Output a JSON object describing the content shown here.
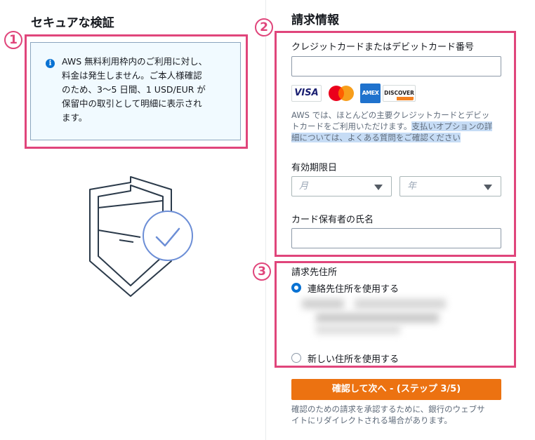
{
  "left": {
    "heading": "セキュアな検証",
    "info_lines": [
      "AWS 無料利用枠内のご利用に対し、",
      "料金は発生しません。ご本人様確認",
      "のため、3〜5 日間、1 USD/EUR が",
      "保留中の取引として明細に表示され",
      "ます。"
    ],
    "info_icon": "i"
  },
  "badges": {
    "one": "1",
    "two": "2",
    "three": "3"
  },
  "billing": {
    "heading": "請求情報",
    "card_number_label": "クレジットカードまたはデビットカード番号",
    "card_number_value": "",
    "card_logos": {
      "visa": "VISA",
      "amex": "AMEX",
      "discover": "DISCOVER"
    },
    "note_line1": "AWS では、ほとんどの主要クレジットカードとデビッ",
    "note_line2_plain": "トカードをご利用いただけます。",
    "note_line2_link": "支払いオプションの詳",
    "note_line3_link": "細については、よくある質問をご確認ください",
    "expiry_label": "有効期限日",
    "month_placeholder": "月",
    "year_placeholder": "年",
    "cardholder_label": "カード保有者の氏名",
    "cardholder_value": ""
  },
  "address": {
    "label": "請求先住所",
    "use_contact": "連絡先住所を使用する",
    "use_new": "新しい住所を使用する"
  },
  "footer": {
    "cta": "確認して次へ - (ステップ 3/5)",
    "note_line1": "確認のための請求を承認するために、銀行のウェブサ",
    "note_line2": "イトにリダイレクトされる場合があります。"
  }
}
